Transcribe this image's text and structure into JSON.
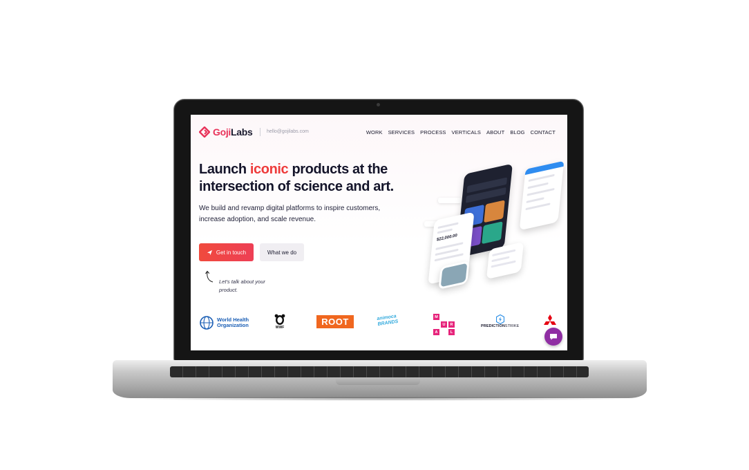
{
  "brand": {
    "name_part1": "Goji",
    "name_part2": "Labs",
    "email": "hello@gojilabs.com",
    "accent_color": "#ee3b3b",
    "brand_pink": "#e8335a"
  },
  "nav": {
    "items": [
      "WORK",
      "SERVICES",
      "PROCESS",
      "VERTICALS",
      "ABOUT",
      "BLOG",
      "CONTACT"
    ]
  },
  "hero": {
    "title_start": "Launch ",
    "title_accent": "iconic",
    "title_end": " products at the intersection of science and art.",
    "subtitle": "We build and revamp digital platforms to inspire customers, increase adoption, and scale revenue.",
    "primary_button": "Get in touch",
    "secondary_button": "What we do",
    "note": "Let's talk about your product."
  },
  "mockup": {
    "amount": "$22,000.00"
  },
  "clients": {
    "who_line1": "World Health",
    "who_line2": "Organization",
    "wwf": "WWF",
    "root": "ROOT",
    "animoca_line1": "animoca",
    "animoca_line2": "BRANDS",
    "mural_letters": [
      "M",
      "U",
      "R",
      "A",
      "L"
    ],
    "prediction_part1": "PREDICTION",
    "prediction_part2": "STRIKE"
  },
  "icons": {
    "send": "paper-plane-icon",
    "arrow": "curved-arrow-icon",
    "chat": "chat-icon"
  }
}
